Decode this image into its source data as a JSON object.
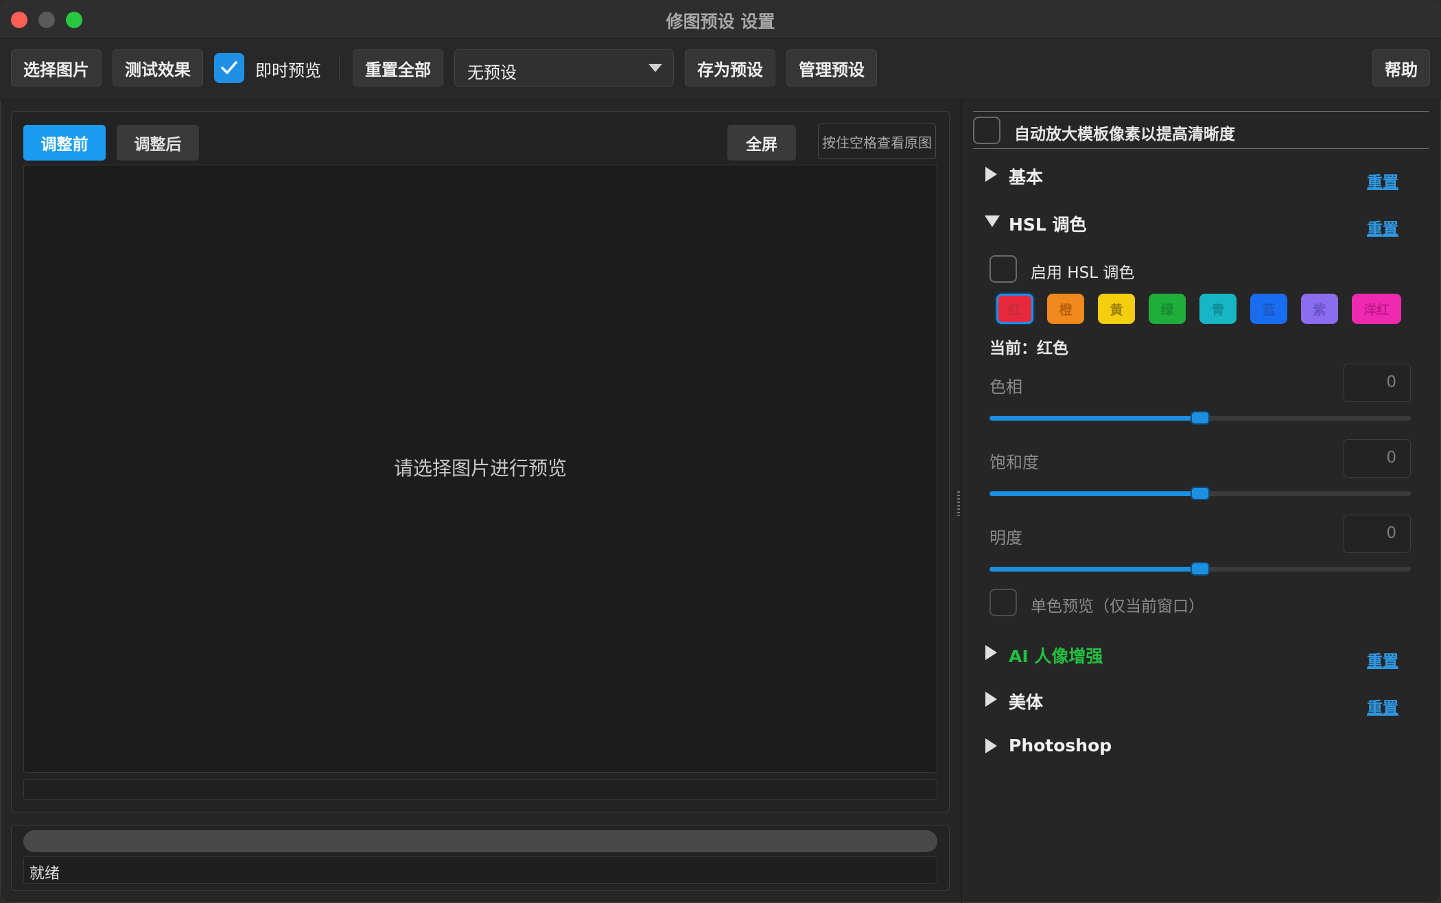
{
  "window": {
    "title": "修图预设 设置"
  },
  "toolbar": {
    "select_image": "选择图片",
    "test_effect": "测试效果",
    "live_preview_label": "即时预览",
    "live_preview_checked": true,
    "reset_all": "重置全部",
    "preset_value": "无预设",
    "save_preset": "存为预设",
    "manage_preset": "管理预设",
    "help": "帮助"
  },
  "preview": {
    "tab_before": "调整前",
    "tab_after": "调整后",
    "fullscreen": "全屏",
    "hold_space": "按住空格查看原图",
    "placeholder": "请选择图片进行预览",
    "status": "就绪"
  },
  "settings": {
    "upscale_label": "自动放大模板像素以提高清晰度",
    "upscale_checked": false,
    "reset_label": "重置",
    "sections": {
      "basic": "基本",
      "hsl": "HSL 调色",
      "ai": "AI 人像增强",
      "body": "美体",
      "photoshop": "Photoshop"
    },
    "hsl": {
      "enable_label": "启用 HSL 调色",
      "enable_checked": false,
      "swatches": [
        {
          "label": "红",
          "color": "#e8283c",
          "text_color": "#c0303c",
          "selected": true
        },
        {
          "label": "橙",
          "color": "#f08a1c",
          "text_color": "#b8620e",
          "selected": false
        },
        {
          "label": "黄",
          "color": "#f4cf10",
          "text_color": "#9c7e00",
          "selected": false
        },
        {
          "label": "绿",
          "color": "#1fae3a",
          "text_color": "#188a2e",
          "selected": false
        },
        {
          "label": "青",
          "color": "#18b6c4",
          "text_color": "#108e98",
          "selected": false
        },
        {
          "label": "蓝",
          "color": "#1a6cf0",
          "text_color": "#1a58c4",
          "selected": false
        },
        {
          "label": "紫",
          "color": "#8a6ef0",
          "text_color": "#6a52c8",
          "selected": false
        },
        {
          "label": "洋红",
          "color": "#f02ab0",
          "text_color": "#c01890",
          "selected": false
        }
      ],
      "current_label": "当前：红色",
      "sliders": [
        {
          "label": "色相",
          "value": "0",
          "fraction": 0.5
        },
        {
          "label": "饱和度",
          "value": "0",
          "fraction": 0.5
        },
        {
          "label": "明度",
          "value": "0",
          "fraction": 0.5
        }
      ],
      "mono_label": "单色预览（仅当前窗口）",
      "mono_checked": false
    },
    "colors": {
      "accent": "#1a9cf0",
      "reset_link": "#2f9be8",
      "ai_section": "#22c040"
    }
  }
}
